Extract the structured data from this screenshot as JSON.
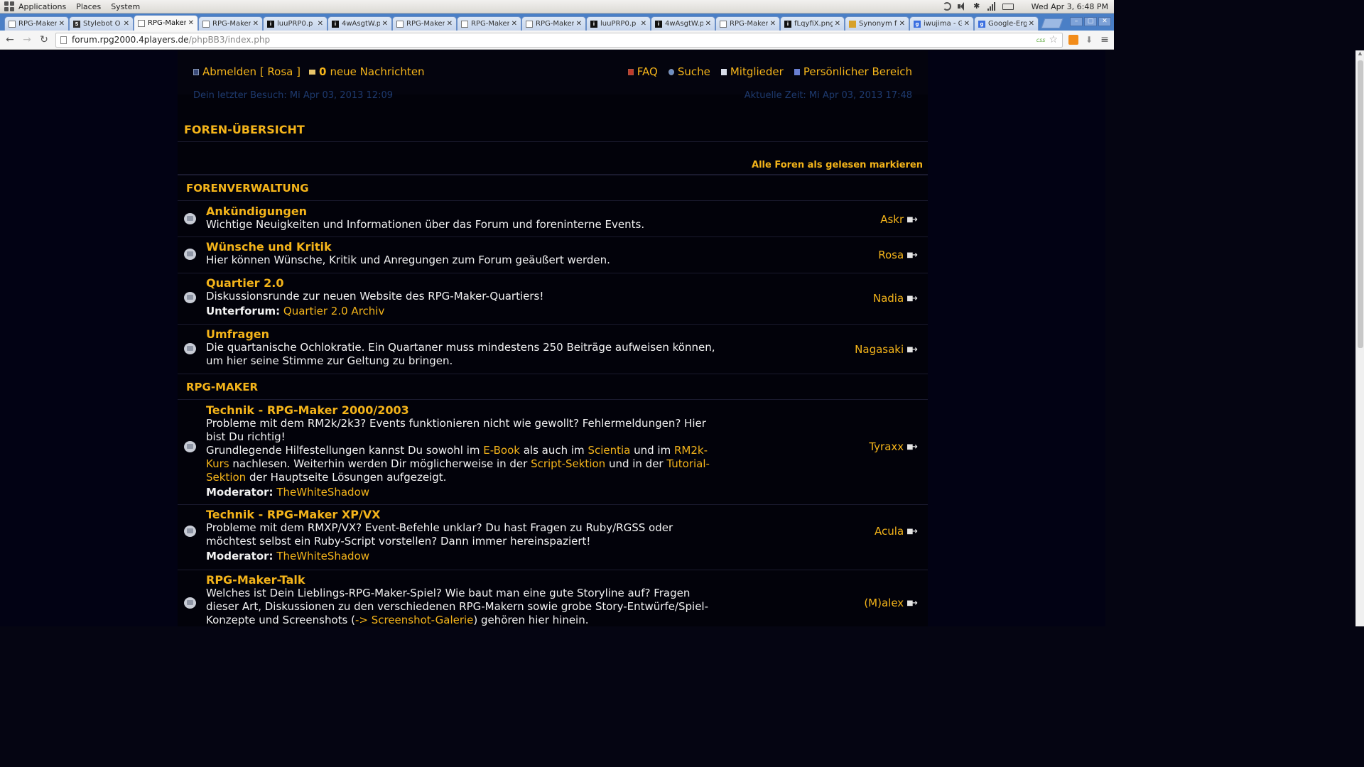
{
  "gnome": {
    "menus": [
      "Applications",
      "Places",
      "System"
    ],
    "clock": "Wed Apr  3,  6:48 PM"
  },
  "tabs": [
    {
      "title": "RPG-Maker",
      "favicon": "page-icon",
      "active": false
    },
    {
      "title": "Stylebot O",
      "favicon": "s",
      "active": false
    },
    {
      "title": "RPG-Maker",
      "favicon": "page-icon",
      "active": true
    },
    {
      "title": "RPG-Maker",
      "favicon": "page-icon",
      "active": false
    },
    {
      "title": "luuPRP0.p",
      "favicon": "i",
      "active": false
    },
    {
      "title": "4wAsgtW.p",
      "favicon": "i",
      "active": false
    },
    {
      "title": "RPG-Maker",
      "favicon": "page-icon",
      "active": false
    },
    {
      "title": "RPG-Maker",
      "favicon": "page-icon",
      "active": false
    },
    {
      "title": "RPG-Maker",
      "favicon": "page-icon",
      "active": false
    },
    {
      "title": "luuPRP0.p",
      "favicon": "i",
      "active": false
    },
    {
      "title": "4wAsgtW.p",
      "favicon": "i",
      "active": false
    },
    {
      "title": "RPG-Maker",
      "favicon": "page-icon",
      "active": false
    },
    {
      "title": "fLqyfiX.png",
      "favicon": "i",
      "active": false
    },
    {
      "title": "Synonym f",
      "favicon": "y",
      "active": false
    },
    {
      "title": "iwujima - G",
      "favicon": "g",
      "active": false
    },
    {
      "title": "Google-Erg",
      "favicon": "g",
      "active": false
    }
  ],
  "url": {
    "host": "forum.rpg2000.4players.de",
    "path": "/phpBB3/index.php",
    "css_badge": "css"
  },
  "nav": {
    "logout": "Abmelden [ Rosa ]",
    "msg_count": "0",
    "msg_label": "neue Nachrichten",
    "faq": "FAQ",
    "search": "Suche",
    "members": "Mitglieder",
    "profile": "Persönlicher Bereich",
    "last_visit": "Dein letzter Besuch: Mi Apr 03, 2013 12:09",
    "current_time": "Aktuelle Zeit: Mi Apr 03, 2013 17:48"
  },
  "overview_title": "FOREN-ÜBERSICHT",
  "mark_all_read": "Alle Foren als gelesen markieren",
  "categories": [
    {
      "name": "FORENVERWALTUNG",
      "forums": [
        {
          "title": "Ankündigungen",
          "desc": "Wichtige Neuigkeiten und Informationen über das Forum und foreninterne Events.",
          "lastpost": "Askr"
        },
        {
          "title": "Wünsche und Kritik",
          "desc": "Hier können Wünsche, Kritik und Anregungen zum Forum geäußert werden.",
          "lastpost": "Rosa"
        },
        {
          "title": "Quartier 2.0",
          "desc": "Diskussionsrunde zur neuen Website des RPG-Maker-Quartiers!",
          "sub_label": "Unterforum:",
          "sub_link": "Quartier 2.0 Archiv",
          "lastpost": "Nadia"
        },
        {
          "title": "Umfragen",
          "desc": "Die quartanische Ochlokratie. Ein Quartaner muss mindestens 250 Beiträge aufweisen können, um hier seine Stimme zur Geltung zu bringen.",
          "lastpost": "Nagasaki"
        }
      ]
    },
    {
      "name": "RPG-MAKER",
      "forums": [
        {
          "title": "Technik - RPG-Maker 2000/2003",
          "desc": "Probleme mit dem RM2k/2k3? Events funktionieren nicht wie gewollt? Fehlermeldungen? Hier bist Du richtig!",
          "desc2_parts": [
            "Grundlegende Hilfestellungen kannst Du sowohl im ",
            "E-Book",
            " als auch im ",
            "Scientia",
            " und im ",
            "RM2k-Kurs",
            " nachlesen. Weiterhin werden Dir möglicherweise in der ",
            "Script-Sektion",
            " und in der ",
            "Tutorial-Sektion",
            " der Hauptseite Lösungen aufgezeigt."
          ],
          "sub_label": "Moderator:",
          "sub_link": "TheWhiteShadow",
          "lastpost": "Tyraxx"
        },
        {
          "title": "Technik - RPG-Maker XP/VX",
          "desc": "Probleme mit dem RMXP/VX? Event-Befehle unklar? Du hast Fragen zu Ruby/RGSS oder möchtest selbst ein Ruby-Script vorstellen? Dann immer hereinspaziert!",
          "sub_label": "Moderator:",
          "sub_link": "TheWhiteShadow",
          "lastpost": "Acula"
        },
        {
          "title": "RPG-Maker-Talk",
          "desc_parts": [
            "Welches ist Dein Lieblings-RPG-Maker-Spiel? Wie baut man eine gute Storyline auf? Fragen dieser Art, Diskussionen zu den verschiedenen RPG-Makern sowie grobe Story-Entwürfe/Spiel-Konzepte und Screenshots (",
            "-> Screenshot-Galerie",
            ") gehören hier hinein."
          ],
          "lastpost": "(M)alex"
        }
      ]
    }
  ],
  "colors": {
    "accent": "#f4b41a",
    "page_bg": "#020214",
    "text": "#f2f2f2",
    "muted": "#1e3a6e"
  }
}
